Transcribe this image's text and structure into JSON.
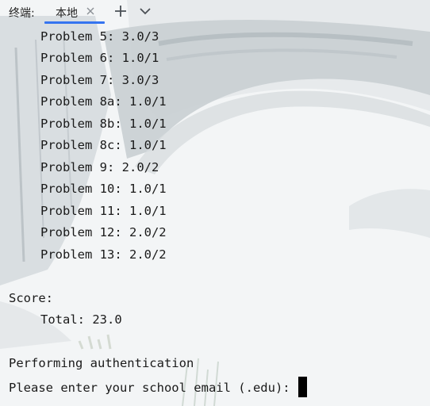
{
  "tabbar": {
    "terminal_label": "终端:",
    "tab_label": "本地",
    "close_icon": "close-icon",
    "add_icon": "plus-icon",
    "menu_icon": "chevron-down-icon",
    "accent": "#3574f0"
  },
  "terminal": {
    "problems": [
      "Problem 5: 3.0/3",
      "Problem 6: 1.0/1",
      "Problem 7: 3.0/3",
      "Problem 8a: 1.0/1",
      "Problem 8b: 1.0/1",
      "Problem 8c: 1.0/1",
      "Problem 9: 2.0/2",
      "Problem 10: 1.0/1",
      "Problem 11: 1.0/1",
      "Problem 12: 2.0/2",
      "Problem 13: 2.0/2"
    ],
    "score_label": "Score:",
    "total": "Total: 23.0",
    "auth_message": "Performing authentication",
    "email_prompt": "Please enter your school email (.edu):"
  }
}
